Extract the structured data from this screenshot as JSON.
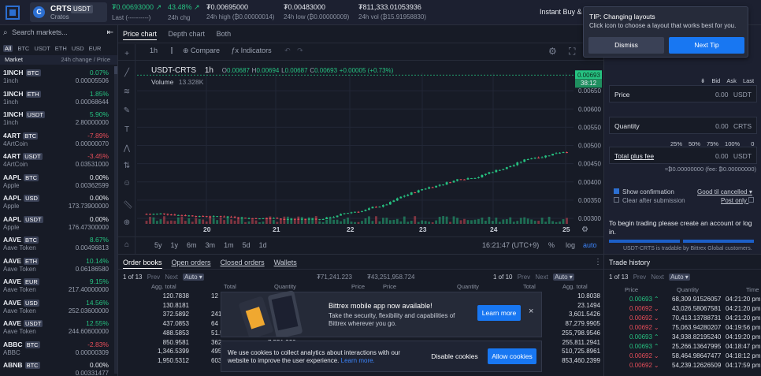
{
  "header": {
    "symbol": "CRTS",
    "quote": "USDT",
    "coin_name": "Cratos",
    "last_value": "₮0.00693000",
    "last_label": "Last (----------)",
    "change_value": "43.48%",
    "change_label": "24h chg",
    "high_value": "₮0.00695000",
    "high_label": "24h high (₿0.00000014)",
    "low_value": "₮0.00483000",
    "low_label": "24h low (₿0.00000009)",
    "vol_value": "₮811,333.01053936",
    "vol_label": "24h vol (₿15.91958830)",
    "instant_link": "Instant Buy & S"
  },
  "sidebar": {
    "search_placeholder": "Search markets...",
    "quote_tabs": [
      "All",
      "BTC",
      "USDT",
      "ETH",
      "USD",
      "EUR"
    ],
    "head_left": "Market",
    "head_right": "24h change  /  Price",
    "markets": [
      {
        "sym": "1INCH",
        "q": "BTC",
        "name": "1inch",
        "chg": "0.07%",
        "price": "0.00005506",
        "dir": "up"
      },
      {
        "sym": "1INCH",
        "q": "ETH",
        "name": "1inch",
        "chg": "1.85%",
        "price": "0.00068644",
        "dir": "up"
      },
      {
        "sym": "1INCH",
        "q": "USDT",
        "name": "1inch",
        "chg": "5.90%",
        "price": "2.80000000",
        "dir": "up"
      },
      {
        "sym": "4ART",
        "q": "BTC",
        "name": "4ArtCoin",
        "chg": "-7.89%",
        "price": "0.00000070",
        "dir": "down"
      },
      {
        "sym": "4ART",
        "q": "USDT",
        "name": "4ArtCoin",
        "chg": "-3.45%",
        "price": "0.03531000",
        "dir": "down"
      },
      {
        "sym": "AAPL",
        "q": "BTC",
        "name": "Apple",
        "chg": "0.00%",
        "price": "0.00362599",
        "dir": "flat"
      },
      {
        "sym": "AAPL",
        "q": "USD",
        "name": "Apple",
        "chg": "0.00%",
        "price": "173.73900000",
        "dir": "flat"
      },
      {
        "sym": "AAPL",
        "q": "USDT",
        "name": "Apple",
        "chg": "0.00%",
        "price": "176.47300000",
        "dir": "flat"
      },
      {
        "sym": "AAVE",
        "q": "BTC",
        "name": "Aave Token",
        "chg": "8.67%",
        "price": "0.00496813",
        "dir": "up"
      },
      {
        "sym": "AAVE",
        "q": "ETH",
        "name": "Aave Token",
        "chg": "10.14%",
        "price": "0.06186580",
        "dir": "up"
      },
      {
        "sym": "AAVE",
        "q": "EUR",
        "name": "Aave Token",
        "chg": "9.15%",
        "price": "217.40000000",
        "dir": "up"
      },
      {
        "sym": "AAVE",
        "q": "USD",
        "name": "Aave Token",
        "chg": "14.56%",
        "price": "252.03600000",
        "dir": "up"
      },
      {
        "sym": "AAVE",
        "q": "USDT",
        "name": "Aave Token",
        "chg": "12.55%",
        "price": "244.60600000",
        "dir": "up"
      },
      {
        "sym": "ABBC",
        "q": "BTC",
        "name": "ABBC",
        "chg": "-2.83%",
        "price": "0.00000309",
        "dir": "down"
      },
      {
        "sym": "ABNB",
        "q": "BTC",
        "name": "",
        "chg": "0.00%",
        "price": "0.00331477",
        "dir": "flat"
      }
    ]
  },
  "chart_tabs": [
    "Price chart",
    "Depth chart",
    "Both"
  ],
  "chart_toolbar": {
    "interval": "1h",
    "compare": "Compare",
    "indicators": "Indicators"
  },
  "chart_legend": {
    "pair": "USDT-CRTS",
    "interval": "1h",
    "o_label": "O",
    "o": "0.00687",
    "h_label": "H",
    "h": "0.00694",
    "l_label": "L",
    "l": "0.00687",
    "c_label": "C",
    "c": "0.00693",
    "change": "+0.00005 (+0.73%)",
    "volume_label": "Volume",
    "volume": "13.328K"
  },
  "chart_data": {
    "type": "candlestick",
    "x_ticks": [
      "20",
      "21",
      "22",
      "23",
      "24",
      "25"
    ],
    "y_ticks": [
      "0.00650",
      "0.00600",
      "0.00550",
      "0.00500",
      "0.00450",
      "0.00400",
      "0.00350",
      "0.00300"
    ],
    "ylim": [
      0.00285,
      0.007
    ],
    "last_price_label": "0.00693",
    "countdown_label": "38:12",
    "grid": true
  },
  "chart_bottom": {
    "ranges": [
      "5y",
      "1y",
      "6m",
      "3m",
      "1m",
      "5d",
      "1d"
    ],
    "time": "16:21:47 (UTC+9)",
    "pct": "%",
    "log": "log",
    "auto": "auto"
  },
  "orders": {
    "tabs": [
      "Order books",
      "Open orders",
      "Closed orders",
      "Wallets"
    ],
    "page_left": "1 of 13",
    "prev": "Prev",
    "next": "Next",
    "auto": "Auto",
    "total_left": "₮71,241.223",
    "total_left2": "₮43,251,958.724",
    "page_right": "1 of 10",
    "head_agg": "Agg. total",
    "head_total": "Total",
    "head_qty": "Quantity",
    "head_price": "Price",
    "bids": [
      "120.7838",
      "130.8181",
      "372.5892",
      "437.0853",
      "488.5853",
      "850.9581",
      "1,346.5399",
      "1,950.5312"
    ],
    "bid_totals": [
      "12",
      "",
      "241",
      "64",
      "51.5000",
      "362",
      "495",
      "603"
    ],
    "bid_qty_partial": [
      "",
      "",
      "",
      "",
      "",
      "7,551.320",
      "",
      ""
    ],
    "bid_price_partial": [
      "",
      "",
      "",
      "",
      "0.00682",
      "",
      "",
      ""
    ],
    "ask_price_partial": [
      "",
      "",
      "",
      "",
      "0.00710",
      "",
      "",
      ""
    ],
    "ask_qty_partial": [
      "",
      "",
      "",
      "",
      "23,735,065.361",
      "",
      "",
      ""
    ],
    "ask_total_partial": [
      "",
      "",
      "",
      "",
      "168,518.9641",
      "",
      "",
      ""
    ],
    "asks": [
      "10.8038",
      "23.1494",
      "3,601.5426",
      "87,279.9905",
      "255,798.9546",
      "255,811.2941",
      "510,725.8961",
      "853,460.2399"
    ]
  },
  "trade_panel": {
    "tip_title": "TIP: Changing layouts",
    "tip_text": "Click icon to choose a layout that works best for you.",
    "dismiss": "Dismiss",
    "next_tip": "Next Tip",
    "bid": "Bid",
    "ask": "Ask",
    "last": "Last",
    "price_label": "Price",
    "price_value": "0.00",
    "price_unit": "USDT",
    "qty_label": "Quantity",
    "qty_value": "0.00",
    "qty_unit": "CRTS",
    "pcts": [
      "25%",
      "50%",
      "75%",
      "100%"
    ],
    "pct_value": "0 %",
    "total_label": "Total plus fee",
    "total_value": "0.00",
    "total_unit": "USDT",
    "fee_text": "≈₿0.00000000 (fee: ₿0.00000000)",
    "show_confirm": "Show confirmation",
    "clear_after": "Clear after submission",
    "good_til": "Good til cancelled",
    "post_only": "Post only",
    "login_text": "To begin trading please create an account or log in.",
    "tradable_text": "USDT-CRTS is tradable by Bittrex Global customers."
  },
  "history": {
    "title": "Trade history",
    "page": "1 of 13",
    "prev": "Prev",
    "next": "Next",
    "auto": "Auto",
    "head_price": "Price",
    "head_qty": "Quantity",
    "head_time": "Time",
    "rows": [
      {
        "price": "0.00693",
        "qty": "68,309.91526057",
        "time": "04:21:20 pm",
        "dir": "up"
      },
      {
        "price": "0.00692",
        "qty": "43,026.58067581",
        "time": "04:21:20 pm",
        "dir": "down"
      },
      {
        "price": "0.00692",
        "qty": "70,413.13788731",
        "time": "04:21:20 pm",
        "dir": "down"
      },
      {
        "price": "0.00692",
        "qty": "75,063.94280207",
        "time": "04:19:56 pm",
        "dir": "down"
      },
      {
        "price": "0.00693",
        "qty": "34,938.82195240",
        "time": "04:19:20 pm",
        "dir": "up"
      },
      {
        "price": "0.00693",
        "qty": "25,266.13647995",
        "time": "04:18:47 pm",
        "dir": "up"
      },
      {
        "price": "0.00692",
        "qty": "58,464.98647477",
        "time": "04:18:12 pm",
        "dir": "down"
      },
      {
        "price": "0.00692",
        "qty": "54,239.12626509",
        "time": "04:17:59 pm",
        "dir": "down"
      }
    ]
  },
  "promo": {
    "title": "Bittrex mobile app now available!",
    "text": "Take the security, flexibility and capabilities of Bittrex wherever you go.",
    "button": "Learn more"
  },
  "cookie": {
    "text": "We use cookies to collect analytics about interactions with our website to improve the user experience.",
    "link": "Learn more.",
    "disable": "Disable cookies",
    "allow": "Allow cookies"
  },
  "colors": {
    "green": "#26c281",
    "red": "#e84e5a",
    "accent": "#1877f2"
  }
}
